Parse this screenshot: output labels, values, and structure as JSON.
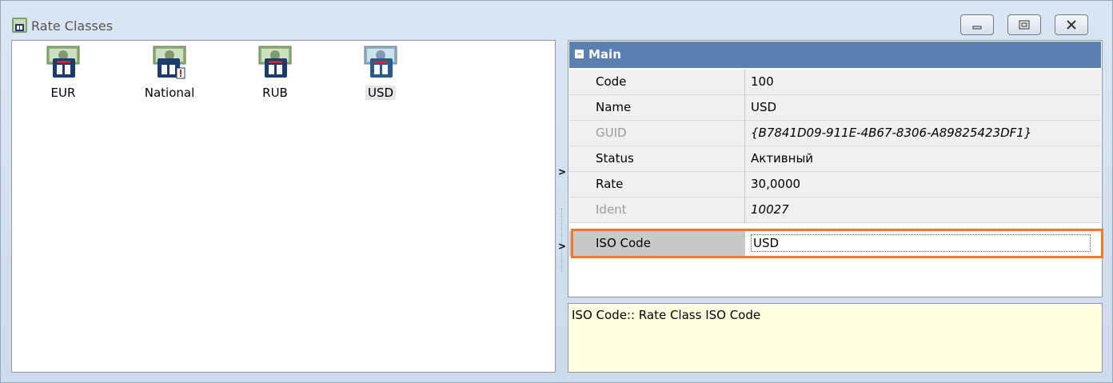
{
  "window": {
    "title": "Rate Classes",
    "buttons": [
      "minimize",
      "maximize",
      "close"
    ]
  },
  "items": [
    {
      "label": "EUR",
      "icon": "currency-class-icon",
      "selected": false,
      "warning": false
    },
    {
      "label": "National",
      "icon": "currency-class-icon",
      "selected": false,
      "warning": true
    },
    {
      "label": "RUB",
      "icon": "currency-class-icon",
      "selected": false,
      "warning": false
    },
    {
      "label": "USD",
      "icon": "currency-class-icon",
      "selected": true,
      "warning": false
    }
  ],
  "properties": {
    "category": "Main",
    "rows": [
      {
        "name": "Code",
        "value": "100"
      },
      {
        "name": "Name",
        "value": "USD"
      },
      {
        "name": "GUID",
        "value": "{B7841D09-911E-4B67-8306-A89825423DF1}"
      },
      {
        "name": "Status",
        "value": "Активный"
      },
      {
        "name": "Rate",
        "value": "30,0000"
      },
      {
        "name": "Ident",
        "value": "10027"
      },
      {
        "name": "ISO Code",
        "value": "USD"
      }
    ]
  },
  "description": "ISO Code:: Rate Class ISO Code",
  "colors": {
    "category_header": "#5a7fb0",
    "description_bg": "#ffffe1",
    "highlight": "#f07a2c"
  }
}
